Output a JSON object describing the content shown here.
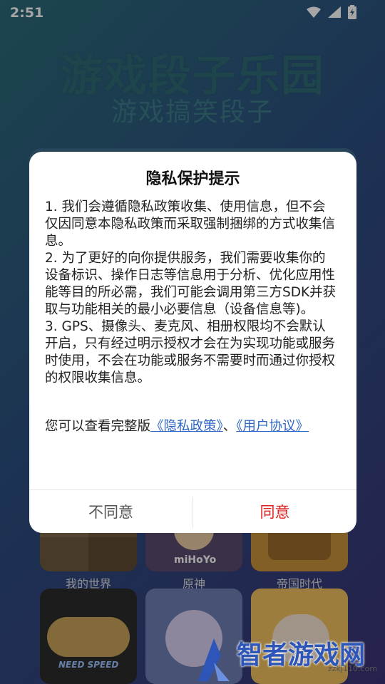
{
  "status_bar": {
    "time": "2:51"
  },
  "app": {
    "title": "游戏段子乐园",
    "subtitle": "游戏搞笑段子"
  },
  "games": [
    {
      "label": "我的世界",
      "thumb_color": "#6d5a3e",
      "icon": "blocks-thumbnail"
    },
    {
      "label": "原神",
      "thumb_color": "#5a4a6e",
      "icon": "character-thumbnail",
      "badge": "miHoYo"
    },
    {
      "label": "帝国时代",
      "thumb_color": "#c7923a",
      "icon": "castle-thumbnail"
    },
    {
      "label": "",
      "thumb_color": "#b9a36a",
      "icon": "car-thumbnail",
      "badge": "NEED SPEED"
    },
    {
      "label": "",
      "thumb_color": "#6d7fb3",
      "icon": "creature-thumbnail"
    },
    {
      "label": "",
      "thumb_color": "#e8a25c",
      "icon": "cat-thumbnail"
    }
  ],
  "dialog": {
    "title": "隐私保护提示",
    "paragraphs": [
      "1. 我们会遵循隐私政策收集、使用信息，但不会仅因同意本隐私政策而采取强制捆绑的方式收集信息。",
      "2. 为了更好的向你提供服务，我们需要收集你的设备标识、操作日志等信息用于分析、优化应用性能等目的所必需，我们可能会调用第三方SDK并获取与功能相关的最小必要信息（设备信息等)。",
      "3. GPS、摄像头、麦克风、相册权限均不会默认开启，只有经过明示授权才会在为实现功能或服务时使用，不会在功能或服务不需要时而通过你授权的权限收集信息。"
    ],
    "footer_prefix": "您可以查看完整版",
    "privacy_link": "《隐私政策》",
    "separator": "、",
    "user_link": "《用户协议》",
    "disagree": "不同意",
    "agree": "同意"
  },
  "watermark": {
    "text": "智者游戏网",
    "url": "zzkj110.com"
  },
  "colors": {
    "accent": "#e02020",
    "link": "#2f66c6",
    "watermark": "#2d56b8"
  }
}
